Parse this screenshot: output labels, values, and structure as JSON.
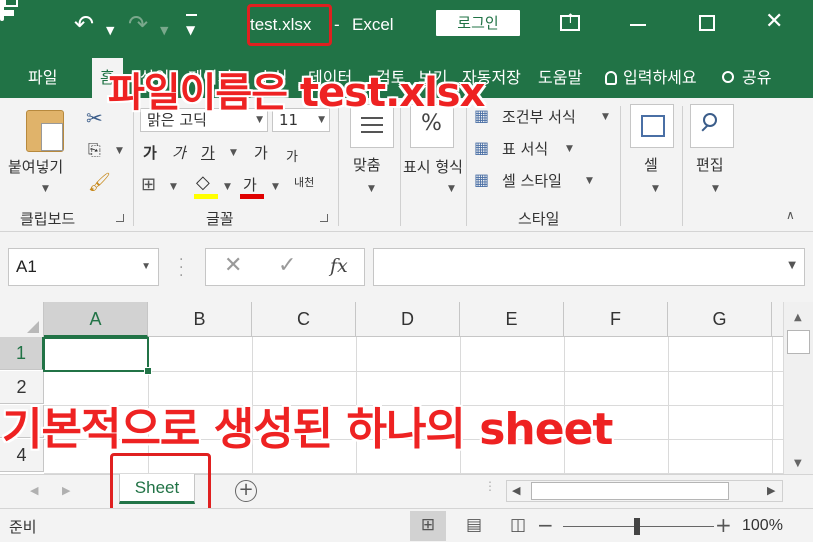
{
  "titlebar": {
    "filename": "test.xlsx",
    "separator": "-",
    "app_name": "Excel",
    "login_label": "로그인",
    "accent": "#217346"
  },
  "tabs": [
    {
      "label": "파일"
    },
    {
      "label": "홈",
      "active": true
    },
    {
      "label": "삽입"
    },
    {
      "label": "페이지"
    },
    {
      "label": "수식"
    },
    {
      "label": "데이터"
    },
    {
      "label": "검토"
    },
    {
      "label": "보기"
    },
    {
      "label": "자동저장"
    },
    {
      "label": "도움말"
    }
  ],
  "tell_me": "입력하세요",
  "share": "공유",
  "ribbon": {
    "clipboard": {
      "paste_label": "붙여넣기",
      "group_label": "클립보드"
    },
    "font": {
      "font_name": "맑은 고딕",
      "font_size": "11",
      "bold": "가",
      "italic": "가",
      "underline": "가",
      "grow": "가",
      "shrink": "가",
      "font_color_glyph": "가",
      "phonetic": "내천",
      "group_label": "글꼴"
    },
    "align": {
      "label": "맞춤"
    },
    "number": {
      "label": "표시 형식",
      "icon": "%"
    },
    "styles": {
      "conditional": "조건부 서식",
      "table": "표 서식",
      "cell_styles": "셀 스타일",
      "group_label": "스타일"
    },
    "cells": {
      "label": "셀"
    },
    "edit": {
      "label": "편집"
    }
  },
  "formula_bar": {
    "name_box": "A1",
    "fx": "fx",
    "value": ""
  },
  "grid": {
    "columns": [
      "A",
      "B",
      "C",
      "D",
      "E",
      "F",
      "G"
    ],
    "rows": [
      "1",
      "2",
      "3",
      "4"
    ],
    "selected_cell": "A1"
  },
  "sheets": [
    {
      "name": "Sheet",
      "active": true
    }
  ],
  "status": {
    "text": "준비",
    "zoom": "100%"
  },
  "annotations": {
    "top": "파일이름은 test.xlsx",
    "middle": "기본적으로 생성된 하나의 sheet",
    "color": "#ee2222"
  }
}
